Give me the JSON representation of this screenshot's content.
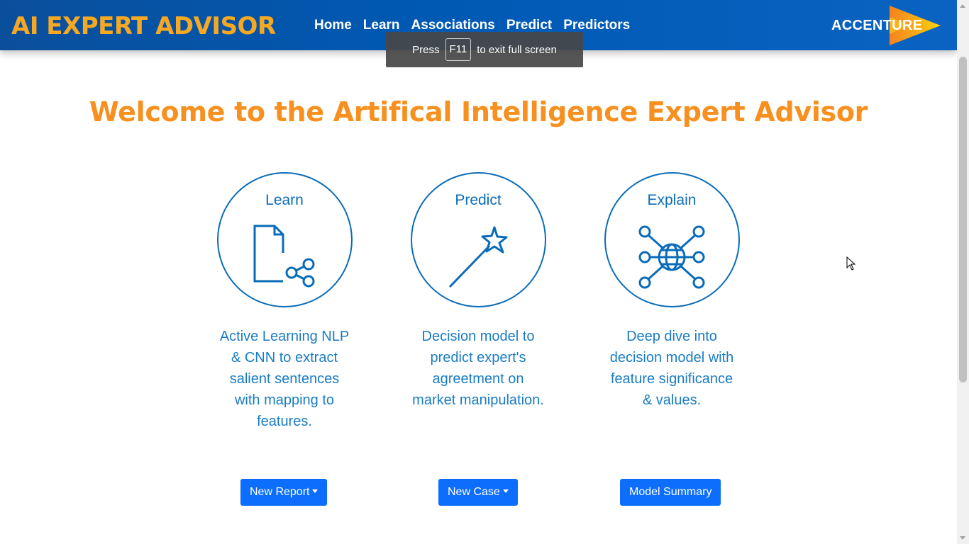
{
  "navbar": {
    "brand": "AI EXPERT ADVISOR",
    "links": [
      "Home",
      "Learn",
      "Associations",
      "Predict",
      "Predictors"
    ],
    "logo_text": "ACCENTURE"
  },
  "fullscreen_toast": {
    "prefix": "Press",
    "key": "F11",
    "suffix": "to exit full screen"
  },
  "main": {
    "title": "Welcome to the Artifical Intelligence Expert Advisor",
    "features": [
      {
        "title": "Learn",
        "icon": "document-share-icon",
        "lines": [
          "Active Learning NLP",
          "& CNN to extract",
          "salient sentences",
          "with mapping to",
          "features."
        ],
        "button": "New Report",
        "has_dropdown": true
      },
      {
        "title": "Predict",
        "icon": "magic-wand-icon",
        "lines": [
          "Decision model to",
          "predict expert's",
          "agreetment on",
          "market manipulation."
        ],
        "button": "New Case",
        "has_dropdown": true
      },
      {
        "title": "Explain",
        "icon": "network-globe-icon",
        "lines": [
          "Deep dive into",
          "decision model with",
          "feature significance",
          "& values."
        ],
        "button": "Model Summary",
        "has_dropdown": false
      }
    ]
  },
  "colors": {
    "navbar": "#0059b3",
    "brand": "#f7a823",
    "title": "#f7901e",
    "feature_blue": "#0a6cb8",
    "button": "#0d6efd"
  }
}
